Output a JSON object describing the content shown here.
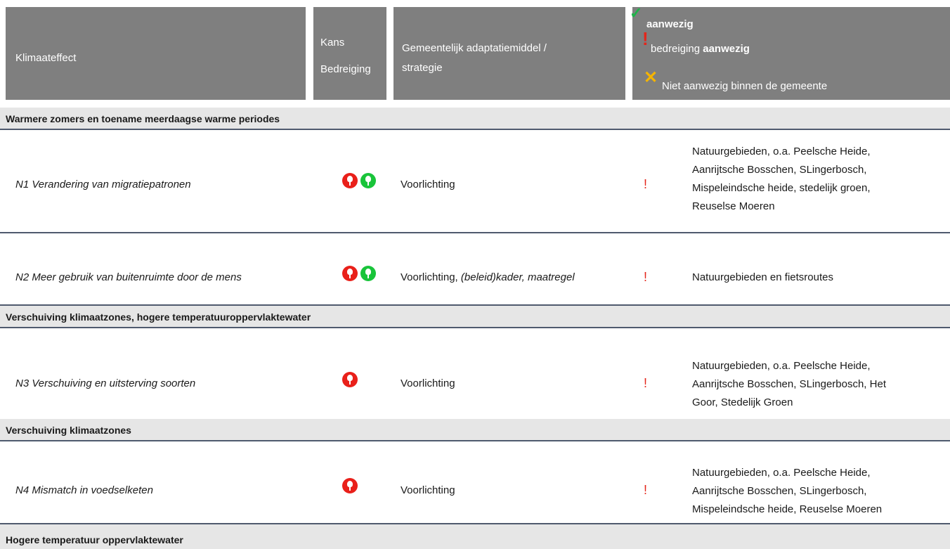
{
  "header": {
    "col_effect": "Klimaateffect",
    "col_kans_line1": "Kans",
    "col_kans_line2": "Bedreiging",
    "col_strategy_line1": "Gemeentelijk adaptatiemiddel /",
    "col_strategy_line2": "strategie",
    "legend": {
      "present": "aanwezig",
      "threat_prefix": "bedreiging",
      "threat_bold": "aanwezig",
      "absent": "Niet aanwezig binnen de gemeente",
      "check_symbol": "✓",
      "bang_symbol": "!",
      "cross_symbol": "✕"
    }
  },
  "sections": [
    {
      "title": "Warmere zomers en toename meerdaagse warme periodes"
    },
    {
      "title": "Verschuiving klimaatzones, hogere temperatuuroppervlaktewater"
    },
    {
      "title": "Verschuiving klimaatzones"
    },
    {
      "title": "Hogere temperatuur oppervlaktewater"
    }
  ],
  "rows": [
    {
      "effect": "N1 Verandering van migratiepatronen",
      "indicators": [
        "threat",
        "opportunity"
      ],
      "strategy_plain": "Voorlichting",
      "strategy_italic": "",
      "status": "!",
      "locations": [
        "Natuurgebieden, o.a. Peelsche Heide,",
        "Aanrijtsche Bosschen, SLingerbosch,",
        "Mispeleindsche heide, stedelijk groen,",
        "Reuselse Moeren"
      ]
    },
    {
      "effect": "N2 Meer gebruik van buitenruimte door de mens",
      "indicators": [
        "threat",
        "opportunity"
      ],
      "strategy_plain": "Voorlichting, ",
      "strategy_italic": "(beleid)kader, maatregel",
      "status": "!",
      "locations": [
        "Natuurgebieden en fietsroutes"
      ]
    },
    {
      "effect": "N3 Verschuiving en uitsterving soorten",
      "indicators": [
        "threat"
      ],
      "strategy_plain": "Voorlichting",
      "strategy_italic": "",
      "status": "!",
      "locations": [
        "Natuurgebieden, o.a. Peelsche Heide,",
        "Aanrijtsche Bosschen, SLingerbosch, Het",
        "Goor, Stedelijk Groen"
      ]
    },
    {
      "effect": "N4 Mismatch in voedselketen",
      "indicators": [
        "threat"
      ],
      "strategy_plain": "Voorlichting",
      "strategy_italic": "",
      "status": "!",
      "locations": [
        "Natuurgebieden, o.a. Peelsche Heide,",
        "Aanrijtsche Bosschen, SLingerbosch,",
        "Mispeleindsche heide, Reuselse Moeren"
      ]
    }
  ],
  "colors": {
    "header_bg": "#7f7f7f",
    "section_bg": "#e6e6e6",
    "rule": "#4f5a6e",
    "threat": "#e9201a",
    "opportunity": "#19c43a",
    "check": "#1fb24a",
    "bang": "#e4261b",
    "cross": "#f4b400"
  }
}
